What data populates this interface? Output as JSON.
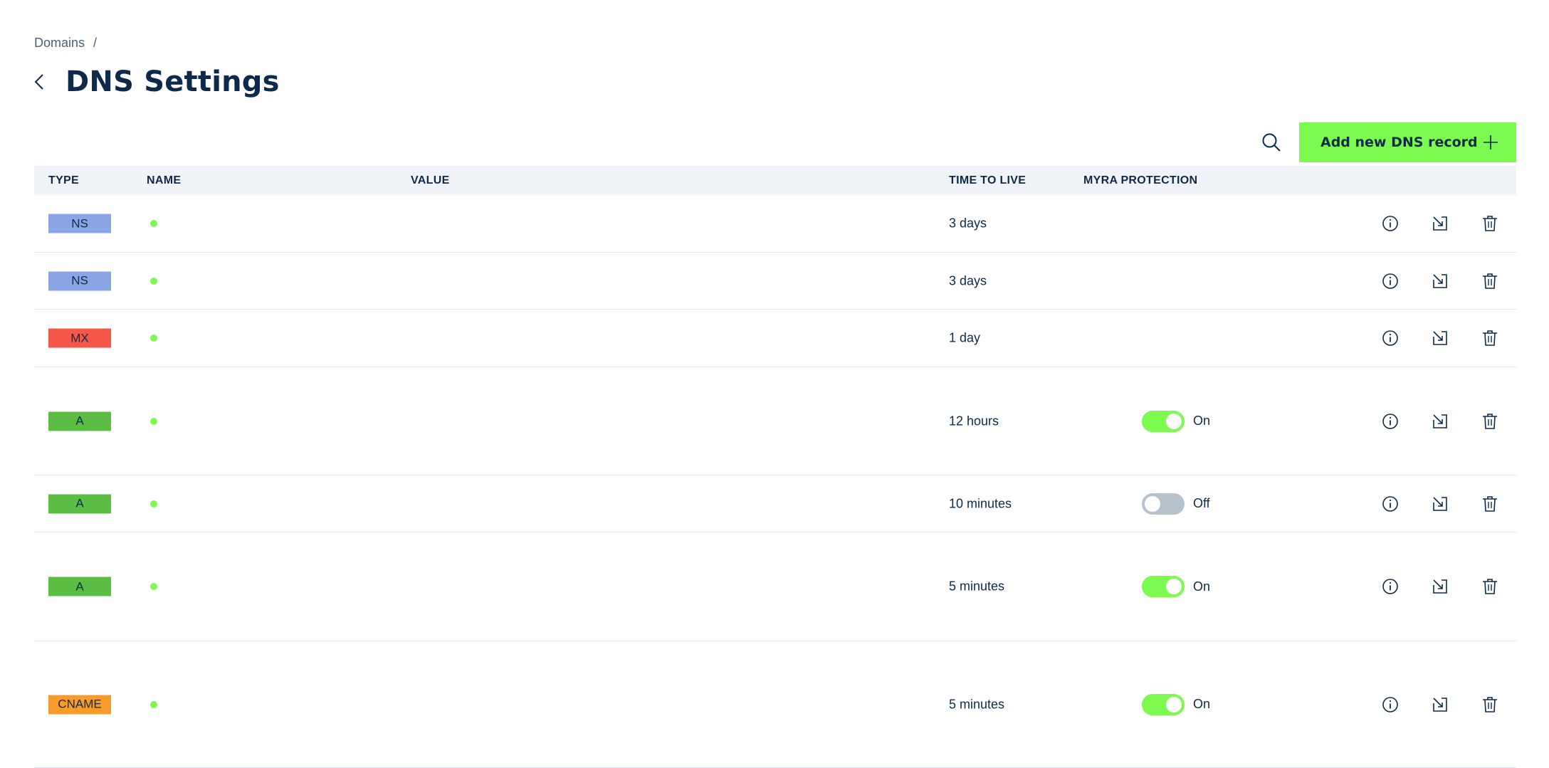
{
  "breadcrumb": {
    "link": "Domains",
    "separator": "/"
  },
  "page": {
    "title": "DNS Settings"
  },
  "toolbar": {
    "add_label": "Add new DNS record"
  },
  "table": {
    "columns": [
      "TYPE",
      "NAME",
      "VALUE",
      "TIME TO LIVE",
      "MYRA PROTECTION"
    ],
    "rows": [
      {
        "type": "NS",
        "type_color": "#8aa5e6",
        "ttl": "3 days",
        "protection": null,
        "protection_label": ""
      },
      {
        "type": "NS",
        "type_color": "#8aa5e6",
        "ttl": "3 days",
        "protection": null,
        "protection_label": ""
      },
      {
        "type": "MX",
        "type_color": "#f5584a",
        "ttl": "1 day",
        "protection": null,
        "protection_label": ""
      },
      {
        "type": "A",
        "type_color": "#5cbd45",
        "ttl": "12 hours",
        "protection": true,
        "protection_label": "On"
      },
      {
        "type": "A",
        "type_color": "#5cbd45",
        "ttl": "10 minutes",
        "protection": false,
        "protection_label": "Off"
      },
      {
        "type": "A",
        "type_color": "#5cbd45",
        "ttl": "5 minutes",
        "protection": true,
        "protection_label": "On"
      },
      {
        "type": "CNAME",
        "type_color": "#f59c2a",
        "ttl": "5 minutes",
        "protection": true,
        "protection_label": "On"
      }
    ]
  },
  "colors": {
    "accent": "#7dfa4f",
    "text": "#0d2a4a",
    "header_bg": "#f0f4f8"
  },
  "icons": [
    "chevron-left-icon",
    "search-icon",
    "plus-icon",
    "info-icon",
    "edit-icon",
    "trash-icon"
  ]
}
